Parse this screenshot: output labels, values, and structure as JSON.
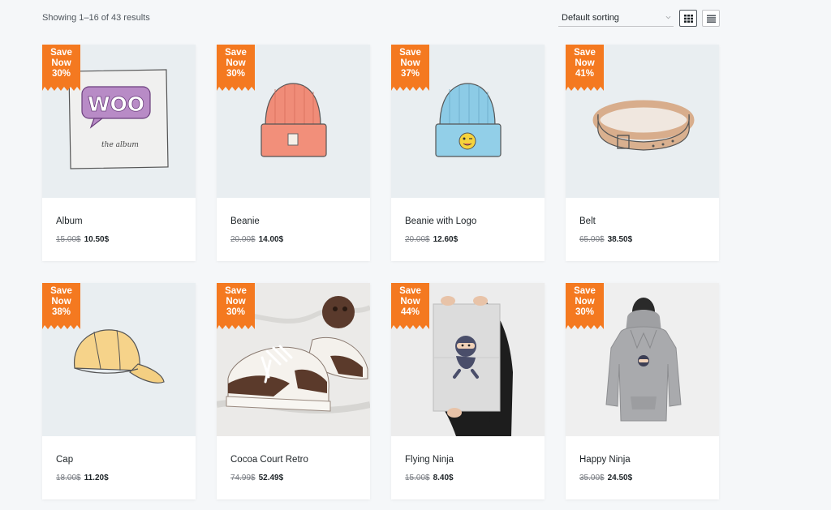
{
  "toolbar": {
    "result_count": "Showing 1–16 of 43 results",
    "sorting_label": "Default sorting",
    "view_grid_icon": "grid-icon",
    "view_list_icon": "list-icon"
  },
  "badge": {
    "line1": "Save",
    "line2": "Now",
    "color": "#f47920"
  },
  "products": [
    {
      "name": "Album",
      "badge_percent": "30%",
      "old_price": "15.00$",
      "new_price": "10.50$"
    },
    {
      "name": "Beanie",
      "badge_percent": "30%",
      "old_price": "20.00$",
      "new_price": "14.00$"
    },
    {
      "name": "Beanie with Logo",
      "badge_percent": "37%",
      "old_price": "20.00$",
      "new_price": "12.60$"
    },
    {
      "name": "Belt",
      "badge_percent": "41%",
      "old_price": "65.00$",
      "new_price": "38.50$"
    },
    {
      "name": "Cap",
      "badge_percent": "38%",
      "old_price": "18.00$",
      "new_price": "11.20$"
    },
    {
      "name": "Cocoa Court Retro",
      "badge_percent": "30%",
      "old_price": "74.99$",
      "new_price": "52.49$"
    },
    {
      "name": "Flying Ninja",
      "badge_percent": "44%",
      "old_price": "15.00$",
      "new_price": "8.40$"
    },
    {
      "name": "Happy Ninja",
      "badge_percent": "30%",
      "old_price": "35.00$",
      "new_price": "24.50$"
    }
  ],
  "album_art_text": {
    "logo": "WOO",
    "caption": "the album"
  }
}
